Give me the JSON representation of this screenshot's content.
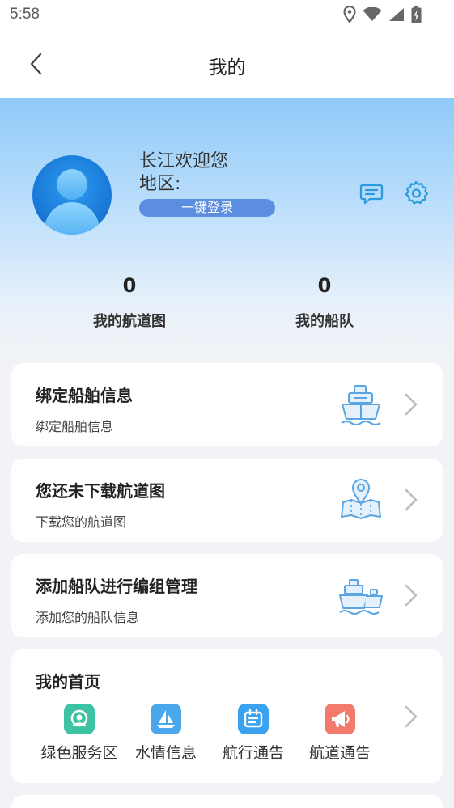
{
  "status_bar": {
    "time": "5:58"
  },
  "nav": {
    "title": "我的"
  },
  "profile": {
    "welcome": "长江欢迎您",
    "region_label": "地区:",
    "login_button": "一键登录"
  },
  "stats": [
    {
      "value": "0",
      "label": "我的航道图"
    },
    {
      "value": "0",
      "label": "我的船队"
    }
  ],
  "cards": [
    {
      "title": "绑定船舶信息",
      "subtitle": "绑定船舶信息",
      "icon": "ship-icon"
    },
    {
      "title": "您还未下载航道图",
      "subtitle": "下载您的航道图",
      "icon": "map-pin-icon"
    },
    {
      "title": "添加船队进行编组管理",
      "subtitle": "添加您的船队信息",
      "icon": "fleet-icon"
    }
  ],
  "homepage": {
    "title": "我的首页",
    "items": [
      {
        "label": "绿色服务区",
        "color": "#3dc3a3",
        "icon": "service-area-icon"
      },
      {
        "label": "水情信息",
        "color": "#4aa7ec",
        "icon": "sailboat-icon"
      },
      {
        "label": "航行通告",
        "color": "#3aa2ef",
        "icon": "notice-icon"
      },
      {
        "label": "航道通告",
        "color": "#f47b6c",
        "icon": "megaphone-icon"
      }
    ]
  },
  "colors": {
    "accent": "#5b8de0",
    "icon_blue": "#3b9bdc",
    "hero_top": "#8fcaf9"
  }
}
